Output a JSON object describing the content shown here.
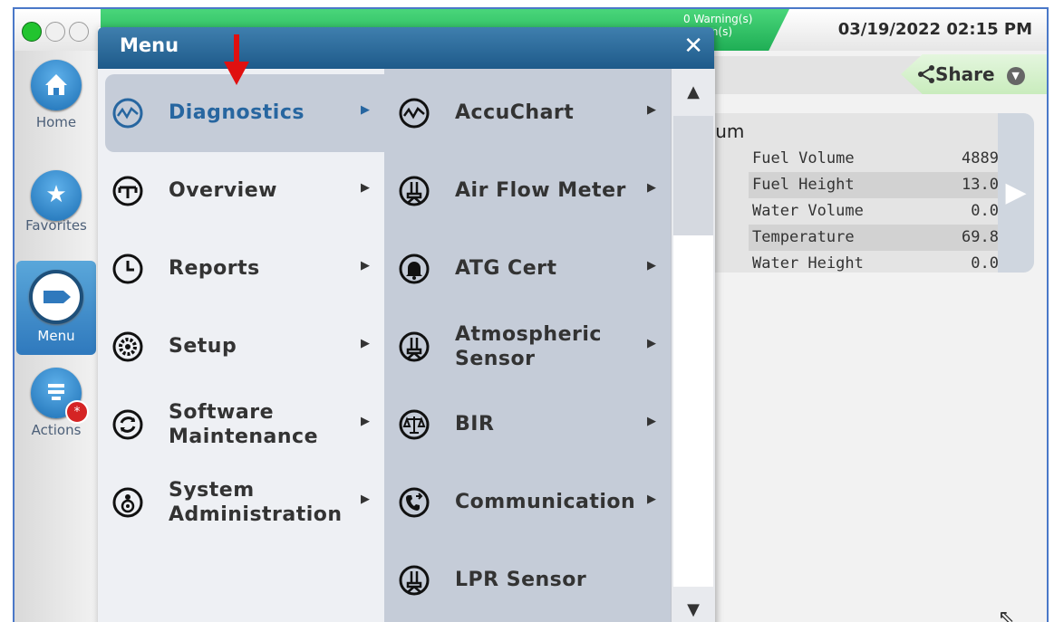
{
  "status": {
    "warnings": "0 Warning(s)",
    "alarms": "rm(s)",
    "datetime": "03/19/2022 02:15 PM"
  },
  "nav": {
    "home": "Home",
    "favorites": "Favorites",
    "menu": "Menu",
    "actions": "Actions",
    "actions_badge": "*"
  },
  "share": {
    "label": "Share"
  },
  "tank": {
    "name": "nium",
    "rows": [
      {
        "label": "Fuel Volume",
        "value": "4889"
      },
      {
        "label": "Fuel Height",
        "value": "13.0"
      },
      {
        "label": "Water Volume",
        "value": "0.0"
      },
      {
        "label": "Temperature",
        "value": "69.8"
      },
      {
        "label": "Water Height",
        "value": "0.0"
      }
    ]
  },
  "menu": {
    "title": "Menu",
    "close": "✕",
    "main_items": [
      {
        "label": "Diagnostics",
        "icon": "chart-wave-icon",
        "selected": true
      },
      {
        "label": "Overview",
        "icon": "tank-overview-icon"
      },
      {
        "label": "Reports",
        "icon": "clock-icon"
      },
      {
        "label": "Setup",
        "icon": "gear-icon"
      },
      {
        "label": "Software Maintenance",
        "icon": "refresh-icon"
      },
      {
        "label": "System Administration",
        "icon": "admin-icon"
      }
    ],
    "sub_items": [
      {
        "label": "AccuChart",
        "icon": "chart-wave-icon"
      },
      {
        "label": "Air Flow Meter",
        "icon": "sensor-icon"
      },
      {
        "label": "ATG Cert",
        "icon": "bell-icon"
      },
      {
        "label": "Atmospheric Sensor",
        "icon": "sensor-icon"
      },
      {
        "label": "BIR",
        "icon": "scale-icon"
      },
      {
        "label": "Communication",
        "icon": "phone-icon"
      },
      {
        "label": "LPR Sensor",
        "icon": "sensor-icon"
      }
    ]
  },
  "colors": {
    "accent_blue": "#2766a0",
    "header_blue": "#1e5a8a",
    "status_green": "#1fae55",
    "pointer_red": "#e01010"
  }
}
